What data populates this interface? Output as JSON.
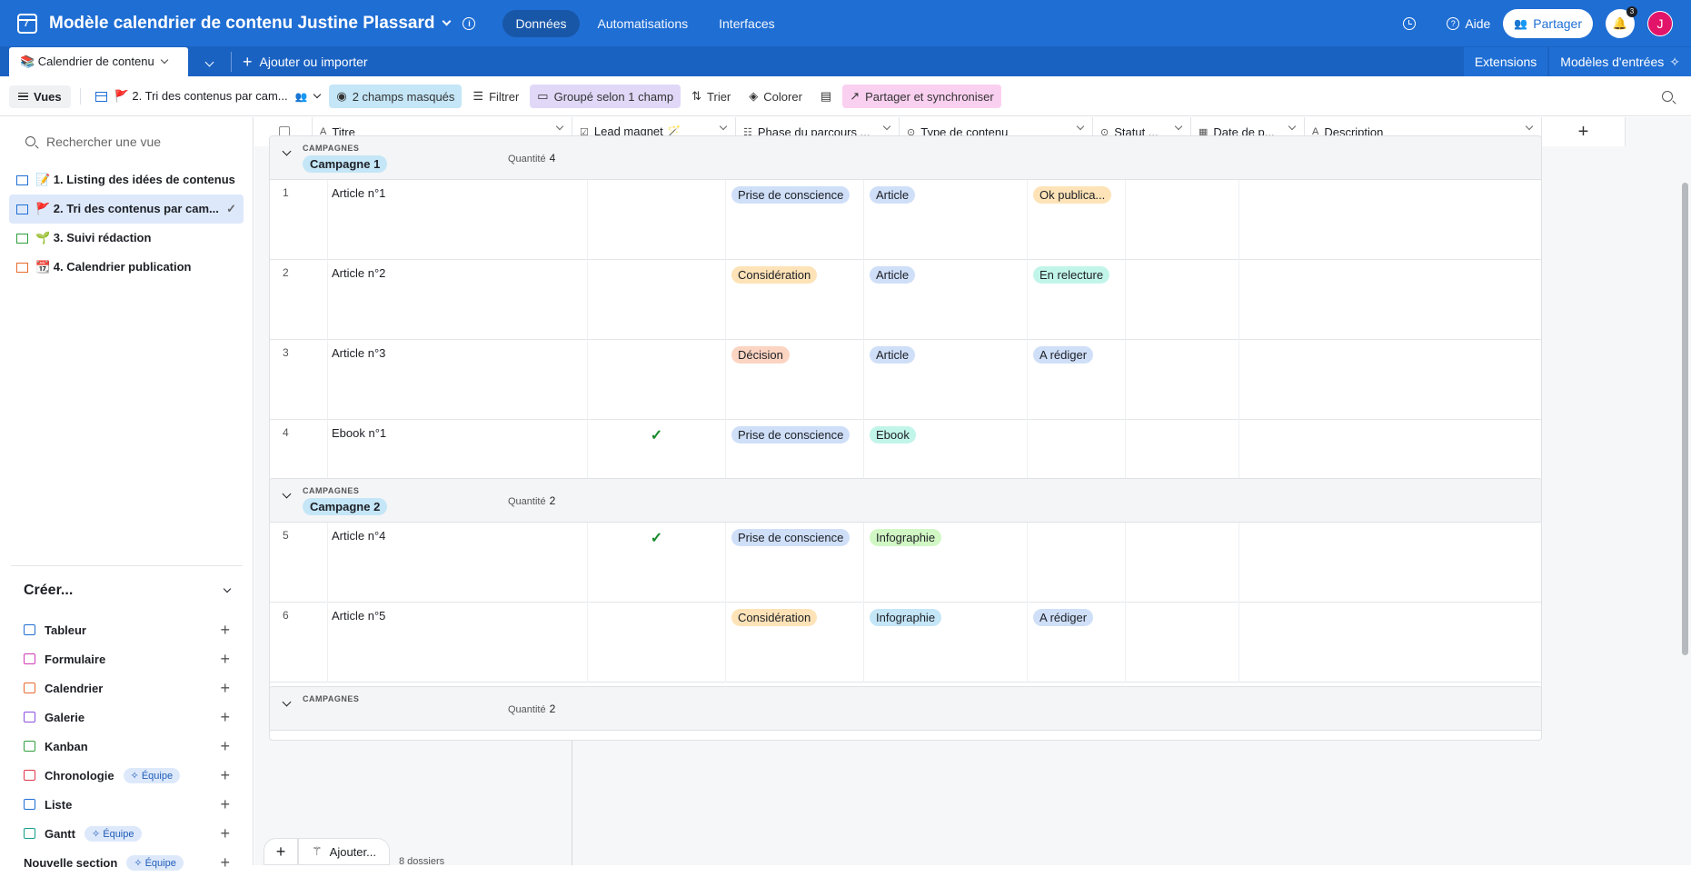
{
  "topbar": {
    "base_title": "Modèle calendrier de contenu Justine Plassard",
    "tabs": [
      "Données",
      "Automatisations",
      "Interfaces"
    ],
    "help": "Aide",
    "share": "Partager",
    "notif_count": "3",
    "avatar_initial": "J",
    "brand_color": "#1f6ed4"
  },
  "tablebar": {
    "table_name": "📚 Calendrier de contenu",
    "add_import": "Ajouter ou importer",
    "extensions": "Extensions",
    "templates": "Modèles d'entrées"
  },
  "toolbar": {
    "views": "Vues",
    "current_view": "🚩 2. Tri des contenus par cam...",
    "hidden_fields": "2 champs masqués",
    "filter": "Filtrer",
    "group": "Groupé selon 1 champ",
    "sort": "Trier",
    "color": "Colorer",
    "sync": "Partager et synchroniser"
  },
  "sidebar": {
    "search_placeholder": "Rechercher une vue",
    "views": [
      {
        "label": "📝 1. Listing des idées de contenus",
        "type": "grid"
      },
      {
        "label": "🚩 2. Tri des contenus par cam...",
        "type": "grid"
      },
      {
        "label": "🌱 3. Suivi rédaction",
        "type": "kanban"
      },
      {
        "label": "📆 4. Calendrier publication",
        "type": "calendar"
      }
    ],
    "create_title": "Créer...",
    "create_items": [
      {
        "label": "Tableur",
        "color": "#1f6ed4",
        "badge": ""
      },
      {
        "label": "Formulaire",
        "color": "#d23ab9",
        "badge": ""
      },
      {
        "label": "Calendrier",
        "color": "#e86a2c",
        "badge": ""
      },
      {
        "label": "Galerie",
        "color": "#8a4ee0",
        "badge": ""
      },
      {
        "label": "Kanban",
        "color": "#2d9f3c",
        "badge": ""
      },
      {
        "label": "Chronologie",
        "color": "#e0364a",
        "badge": "Équipe"
      },
      {
        "label": "Liste",
        "color": "#1f6ed4",
        "badge": ""
      },
      {
        "label": "Gantt",
        "color": "#169d8a",
        "badge": "Équipe"
      }
    ],
    "new_section": "Nouvelle section",
    "new_section_badge": "Équipe"
  },
  "columns": {
    "title": "Titre",
    "lead": "Lead magnet 🪄",
    "phase": "Phase du parcours ...",
    "type": "Type de contenu",
    "status": "Statut ...",
    "date": "Date de p...",
    "description": "Description"
  },
  "groups": [
    {
      "label": "CAMPAGNES",
      "name": "Campagne 1",
      "qty_label": "Quantité",
      "qty": "4",
      "rows": [
        {
          "num": "1",
          "title": "Article n°1",
          "lead": false,
          "phase": "Prise de conscience",
          "phase_class": "p-blue",
          "type": "Article",
          "type_class": "p-blue",
          "status": "Ok publica...",
          "status_class": "p-orange"
        },
        {
          "num": "2",
          "title": "Article n°2",
          "lead": false,
          "phase": "Considération",
          "phase_class": "p-orange",
          "type": "Article",
          "type_class": "p-blue",
          "status": "En relecture",
          "status_class": "p-teal"
        },
        {
          "num": "3",
          "title": "Article n°3",
          "lead": false,
          "phase": "Décision",
          "phase_class": "p-salmon",
          "type": "Article",
          "type_class": "p-blue",
          "status": "A rédiger",
          "status_class": "p-blue"
        },
        {
          "num": "4",
          "title": "Ebook n°1",
          "lead": true,
          "phase": "Prise de conscience",
          "phase_class": "p-blue",
          "type": "Ebook",
          "type_class": "p-teal",
          "status": "",
          "status_class": ""
        }
      ]
    },
    {
      "label": "CAMPAGNES",
      "name": "Campagne 2",
      "qty_label": "Quantité",
      "qty": "2",
      "rows": [
        {
          "num": "5",
          "title": "Article n°4",
          "lead": true,
          "phase": "Prise de conscience",
          "phase_class": "p-blue",
          "type": "Infographie",
          "type_class": "p-green",
          "status": "",
          "status_class": ""
        },
        {
          "num": "6",
          "title": "Article n°5",
          "lead": false,
          "phase": "Considération",
          "phase_class": "p-orange",
          "type": "Infographie",
          "type_class": "p-sky",
          "status": "A rédiger",
          "status_class": "p-blue"
        }
      ]
    },
    {
      "label": "CAMPAGNES",
      "name": "",
      "qty_label": "Quantité",
      "qty": "2",
      "rows": []
    }
  ],
  "bottom": {
    "add_label": "Ajouter...",
    "records_count": "8 dossiers"
  }
}
